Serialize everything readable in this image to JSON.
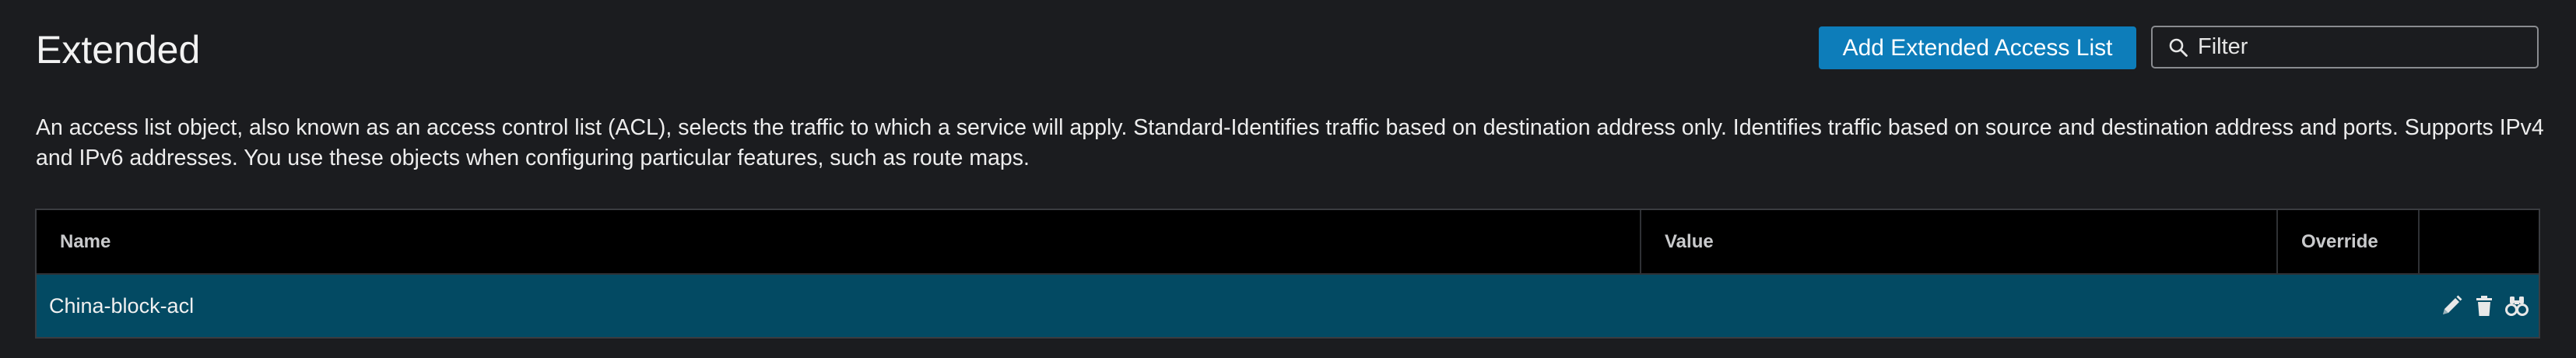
{
  "header": {
    "title": "Extended",
    "add_button_label": "Add Extended Access List",
    "filter": {
      "placeholder": "Filter",
      "value": "",
      "icon": "search-icon"
    }
  },
  "description": "An access list object, also known as an access control list (ACL), selects the traffic to which a service will apply. Standard-Identifies traffic based on destination address only. Identifies traffic based on source and destination address and ports. Supports IPv4 and IPv6 addresses. You use these objects when configuring particular features, such as route maps.",
  "table": {
    "columns": [
      "Name",
      "Value",
      "Override",
      ""
    ],
    "rows": [
      {
        "name": "China-block-acl",
        "value": "",
        "override": "",
        "actions": [
          "edit-icon",
          "delete-icon",
          "usage-binoculars-icon"
        ]
      }
    ]
  },
  "colors": {
    "background": "#1b1c1f",
    "accent_button": "#0d7dba",
    "table_header": "#000000",
    "selected_row": "#034a63"
  }
}
